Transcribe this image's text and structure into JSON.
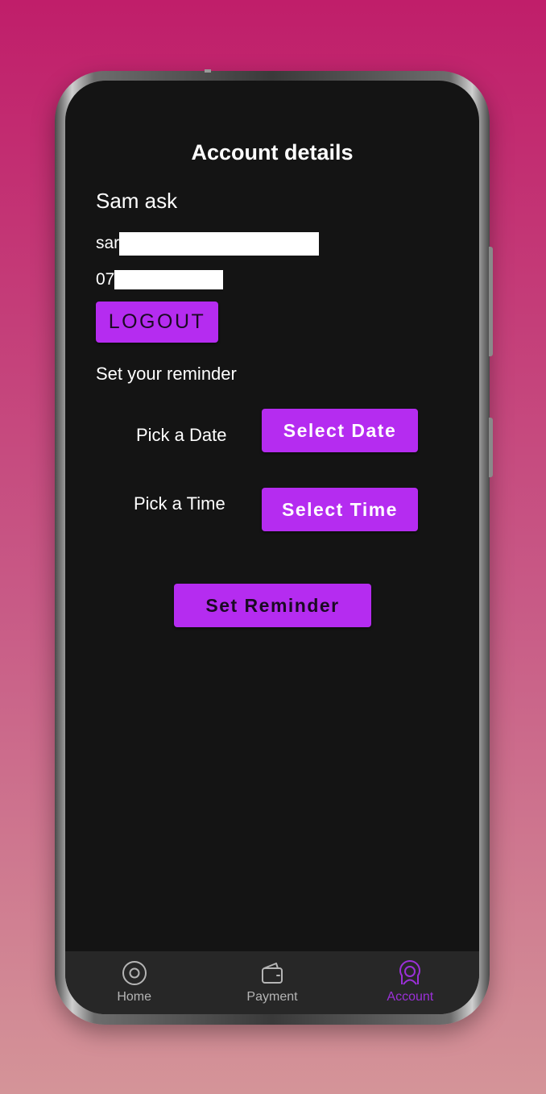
{
  "header": {
    "title": "Account details"
  },
  "account": {
    "name": "Sam ask",
    "email_visible": "sar",
    "phone_visible": "07",
    "logout_label": "LOGOUT"
  },
  "reminder": {
    "heading": "Set your reminder",
    "pick_date_label": "Pick a Date",
    "select_date_label": "Select Date",
    "pick_time_label": "Pick a Time",
    "select_time_label": "Select Time",
    "set_reminder_label": "Set Reminder"
  },
  "nav": {
    "items": [
      {
        "label": "Home",
        "icon": "home-circle-icon",
        "active": false
      },
      {
        "label": "Payment",
        "icon": "wallet-icon",
        "active": false
      },
      {
        "label": "Account",
        "icon": "user-icon",
        "active": true
      }
    ]
  },
  "colors": {
    "accent": "#b52cf0",
    "nav_active": "#9b30d8",
    "screen_bg": "#141414",
    "nav_bg": "#272727",
    "background_top": "#c01e6a",
    "background_bottom": "#d49498"
  }
}
